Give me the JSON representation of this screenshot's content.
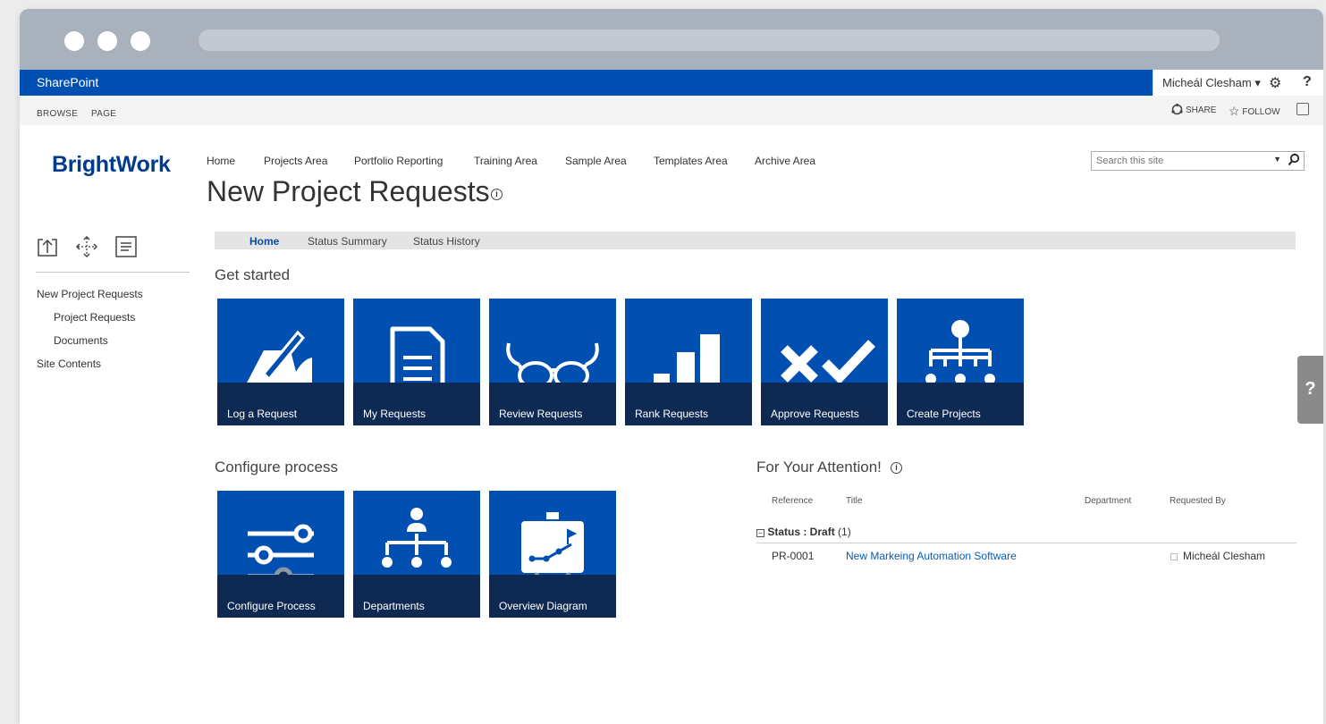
{
  "suite": {
    "brand": "SharePoint",
    "user": "Micheál Clesham ▾",
    "settings_icon": "gear-icon",
    "help_label": "?"
  },
  "ribbon": {
    "browse": "BROWSE",
    "page": "PAGE",
    "share": "SHARE",
    "follow": "FOLLOW"
  },
  "site": {
    "logo": "BrightWork"
  },
  "topnav": [
    "Home",
    "Projects Area",
    "Portfolio Reporting",
    "Training Area",
    "Sample Area",
    "Templates Area",
    "Archive Area"
  ],
  "page": {
    "title": "New Project Requests"
  },
  "search": {
    "placeholder": "Search this site"
  },
  "quicklaunch": {
    "root": "New Project Requests",
    "items": [
      "Project Requests",
      "Documents"
    ],
    "site_contents": "Site Contents"
  },
  "tabs": [
    "Home",
    "Status Summary",
    "Status History"
  ],
  "get_started": {
    "heading": "Get started",
    "tiles": [
      "Log a Request",
      "My Requests",
      "Review Requests",
      "Rank Requests",
      "Approve Requests",
      "Create Projects"
    ]
  },
  "configure": {
    "heading": "Configure process",
    "tiles": [
      "Configure Process",
      "Departments",
      "Overview Diagram"
    ]
  },
  "attention": {
    "heading": "For Your Attention!",
    "columns": [
      "Reference",
      "Title",
      "Department",
      "Requested By"
    ],
    "group_label": "Status : Draft",
    "group_count": "(1)",
    "rows": [
      {
        "reference": "PR-0001",
        "title": "New Markeing Automation Software",
        "department": "",
        "requested_by": "Micheál Clesham"
      }
    ]
  },
  "help_tab": "?",
  "colors": {
    "suite_blue": "#0050b3",
    "tile_blue": "#004fb1",
    "tile_bar": "#0f2a52",
    "link": "#0b5bb5"
  }
}
